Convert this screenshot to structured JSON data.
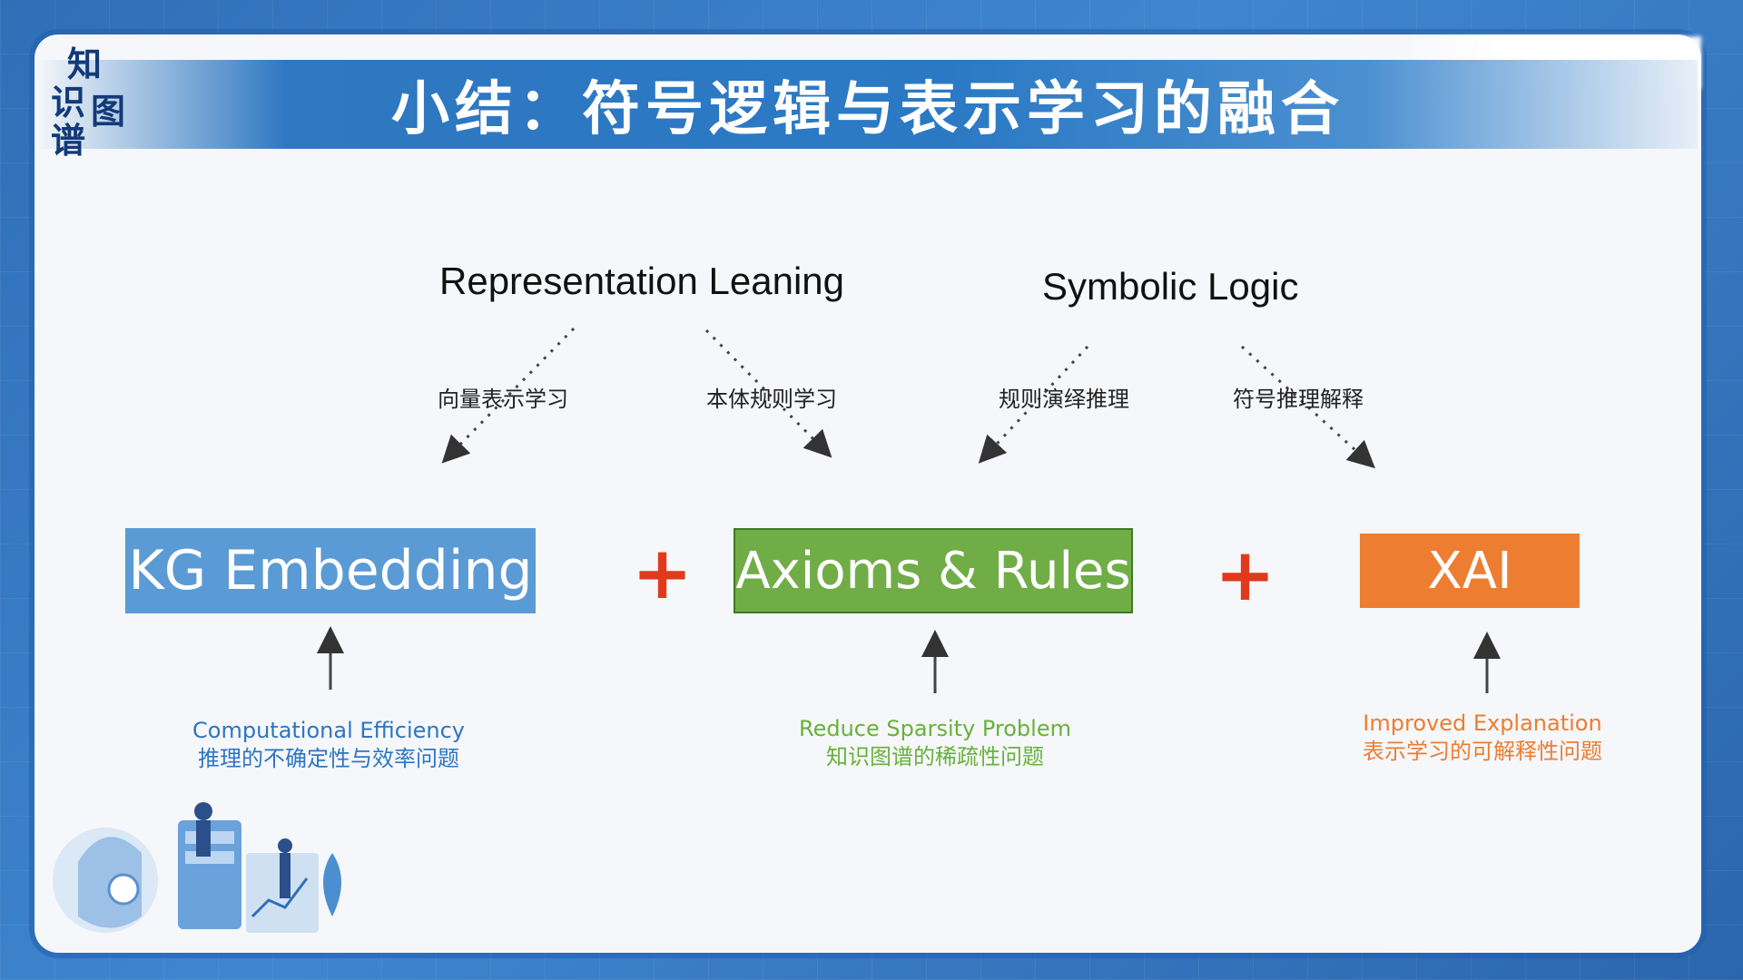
{
  "slide": {
    "title": "小结：符号逻辑与表示学习的融合",
    "logo": {
      "chars": [
        "知",
        "识",
        "图",
        "谱"
      ]
    }
  },
  "diagram": {
    "top_nodes": [
      {
        "label": "Representation Leaning"
      },
      {
        "label": "Symbolic Logic"
      }
    ],
    "edge_labels": [
      "向量表示学习",
      "本体规则学习",
      "规则演绎推理",
      "符号推理解释"
    ],
    "boxes": [
      {
        "label": "KG Embedding",
        "color": "#5b9bd5"
      },
      {
        "label": "Axioms & Rules",
        "color": "#70ad47"
      },
      {
        "label": "XAI",
        "color": "#ed7d31"
      }
    ],
    "operator": "+",
    "notes": [
      {
        "en": "Computational Efficiency",
        "zh": "推理的不确定性与效率问题",
        "color": "#2e75c4"
      },
      {
        "en": "Reduce Sparsity Problem",
        "zh": "知识图谱的稀疏性问题",
        "color": "#69b13a"
      },
      {
        "en": "Improved Explanation",
        "zh": "表示学习的可解释性问题",
        "color": "#ed7d31"
      }
    ]
  }
}
